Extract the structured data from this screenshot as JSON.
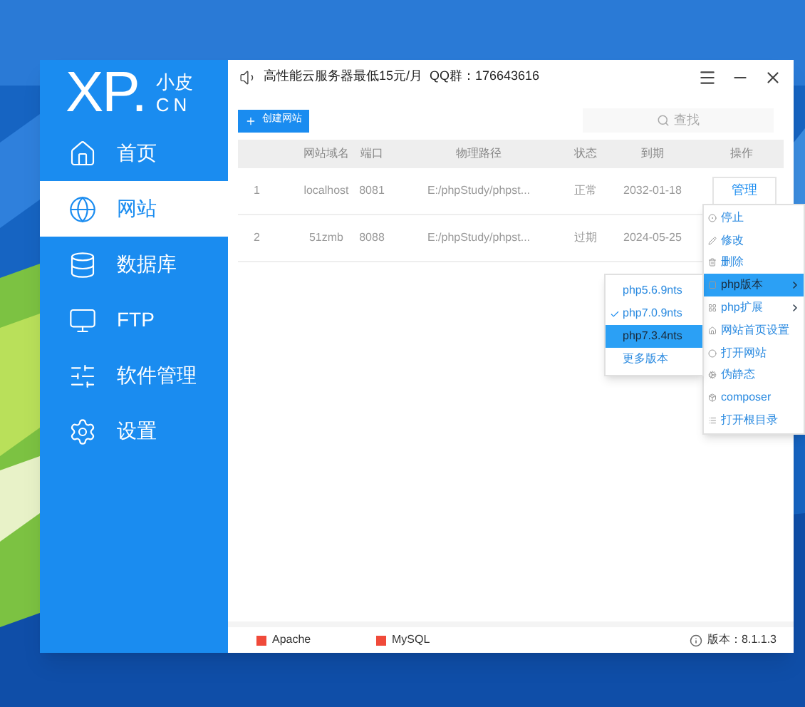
{
  "logo": {
    "mark": "XP.",
    "sub_top": "小皮",
    "sub_bottom": "CN"
  },
  "sidebar": {
    "items": [
      {
        "label": "首页",
        "selected": false
      },
      {
        "label": "网站",
        "selected": true
      },
      {
        "label": "数据库",
        "selected": false
      },
      {
        "label": "FTP",
        "selected": false
      },
      {
        "label": "软件管理",
        "selected": false
      },
      {
        "label": "设置",
        "selected": false
      }
    ]
  },
  "title_bar": {
    "notice": "高性能云服务器最低15元/月  QQ群：176643616"
  },
  "toolbar": {
    "create_button": "创建网站",
    "search": {
      "placeholder": "查找"
    }
  },
  "table": {
    "columns": [
      "",
      "网站域名",
      "端口",
      "物理路径",
      "状态",
      "到期",
      "操作"
    ],
    "rows": [
      {
        "cells": [
          "1",
          "localhost",
          "8081",
          "E:/phpStudy/phpst...",
          "正常",
          "2032-01-18"
        ],
        "action": "管理"
      },
      {
        "cells": [
          "2",
          "51zmb",
          "8088",
          "E:/phpStudy/phpst...",
          "过期",
          "2024-05-25"
        ]
      }
    ]
  },
  "context_menu": {
    "items": [
      {
        "label": "停止",
        "selected": false,
        "submenu": false
      },
      {
        "label": "修改",
        "selected": false,
        "submenu": false
      },
      {
        "label": "删除",
        "selected": false,
        "submenu": false
      },
      {
        "label": "php版本",
        "selected": true,
        "submenu": true
      },
      {
        "label": "php扩展",
        "selected": false,
        "submenu": true
      },
      {
        "label": "网站首页设置",
        "selected": false,
        "submenu": false
      },
      {
        "label": "打开网站",
        "selected": false,
        "submenu": false
      },
      {
        "label": "伪静态",
        "selected": false,
        "submenu": false
      },
      {
        "label": "composer",
        "selected": false,
        "submenu": false
      },
      {
        "label": "打开根目录",
        "selected": false,
        "submenu": false
      }
    ]
  },
  "submenu": {
    "items": [
      {
        "label": "php5.6.9nts",
        "checked": false,
        "selected": false
      },
      {
        "label": "php7.0.9nts",
        "checked": true,
        "selected": false
      },
      {
        "label": "php7.3.4nts",
        "checked": false,
        "selected": true
      },
      {
        "label": "更多版本",
        "checked": false,
        "selected": false
      }
    ]
  },
  "status_bar": {
    "services": [
      {
        "name": "Apache",
        "color": "#f04a3a"
      },
      {
        "name": "MySQL",
        "color": "#f04a3a"
      }
    ],
    "version": "版本：8.1.1.3"
  }
}
